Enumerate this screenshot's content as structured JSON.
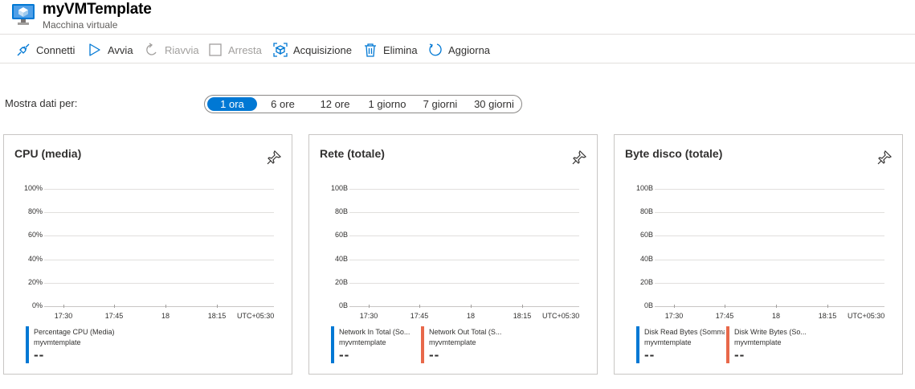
{
  "header": {
    "title": "myVMTemplate",
    "subtitle": "Macchina virtuale",
    "icon": "virtual-machine-icon"
  },
  "toolbar": {
    "connect": "Connetti",
    "start": "Avvia",
    "restart": "Riavvia",
    "stop": "Arresta",
    "capture": "Acquisizione",
    "delete": "Elimina",
    "refresh": "Aggiorna"
  },
  "time_range": {
    "label": "Mostra dati per:",
    "options": [
      "1 ora",
      "6 ore",
      "12 ore",
      "1 giorno",
      "7 giorni",
      "30 giorni"
    ],
    "selected": "1 ora"
  },
  "colors": {
    "accent": "#0078d4",
    "series_blue": "#0078d4",
    "series_orange": "#e8684a"
  },
  "charts": {
    "cpu": {
      "title": "CPU (media)",
      "y_ticks": [
        "100%",
        "80%",
        "60%",
        "40%",
        "20%",
        "0%"
      ],
      "x_ticks": [
        "17:30",
        "17:45",
        "18",
        "18:15"
      ],
      "timezone": "UTC+05:30",
      "legend": [
        {
          "name": "Percentage CPU (Media)",
          "resource": "myvmtemplate",
          "value": "--"
        }
      ]
    },
    "network": {
      "title": "Rete (totale)",
      "y_ticks": [
        "100B",
        "80B",
        "60B",
        "40B",
        "20B",
        "0B"
      ],
      "x_ticks": [
        "17:30",
        "17:45",
        "18",
        "18:15"
      ],
      "timezone": "UTC+05:30",
      "legend": [
        {
          "name": "Network In Total (So...",
          "resource": "myvmtemplate",
          "value": "--"
        },
        {
          "name": "Network Out Total (S...",
          "resource": "myvmtemplate",
          "value": "--"
        }
      ]
    },
    "disk": {
      "title": "Byte disco (totale)",
      "y_ticks": [
        "100B",
        "80B",
        "60B",
        "40B",
        "20B",
        "0B"
      ],
      "x_ticks": [
        "17:30",
        "17:45",
        "18",
        "18:15"
      ],
      "timezone": "UTC+05:30",
      "legend": [
        {
          "name": "Disk Read Bytes (Somma)",
          "resource": "myvmtemplate",
          "value": "--"
        },
        {
          "name": "Disk Write Bytes (So...",
          "resource": "myvmtemplate",
          "value": "--"
        }
      ]
    }
  }
}
